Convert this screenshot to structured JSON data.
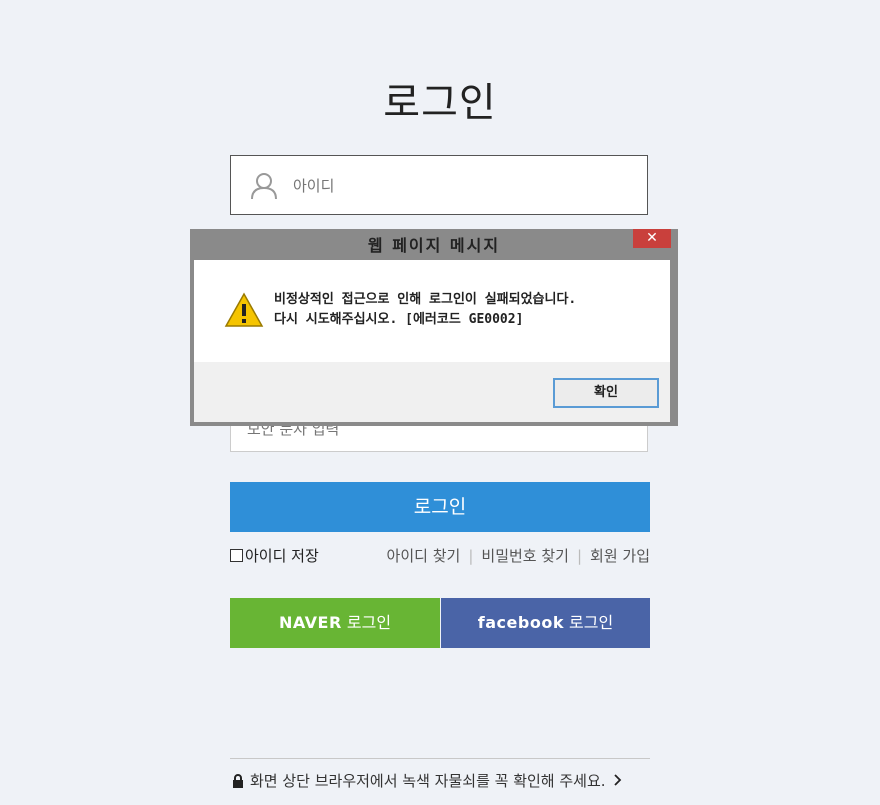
{
  "page": {
    "title": "로그인",
    "id_placeholder": "아이디",
    "captcha_placeholder": "보안 문자 입력",
    "login_button": "로그인",
    "save_id": "아이디 저장",
    "links": [
      "아이디 찾기",
      "비밀번호 찾기",
      "회원 가입"
    ],
    "naver_brand": "NAVER",
    "naver_suffix": "로그인",
    "facebook_brand": "facebook",
    "facebook_suffix": "로그인",
    "notice": "화면 상단 브라우저에서 녹색 자물쇠를 꼭 확인해 주세요.",
    "colors": {
      "primary": "#2f8fd8",
      "naver": "#68b534",
      "facebook": "#4a64a7",
      "background": "#eff2f7"
    }
  },
  "dialog": {
    "title": "웹 페이지 메시지",
    "close": "✕",
    "message_line1": "비정상적인 접근으로 인해 로그인이 실패되었습니다.",
    "message_line2": "다시 시도해주십시오.  [에러코드 GE0002]",
    "ok_button": "확인"
  },
  "icons": [
    "user-icon",
    "warning-icon",
    "lock-icon",
    "chevron-right-icon",
    "close-icon"
  ]
}
